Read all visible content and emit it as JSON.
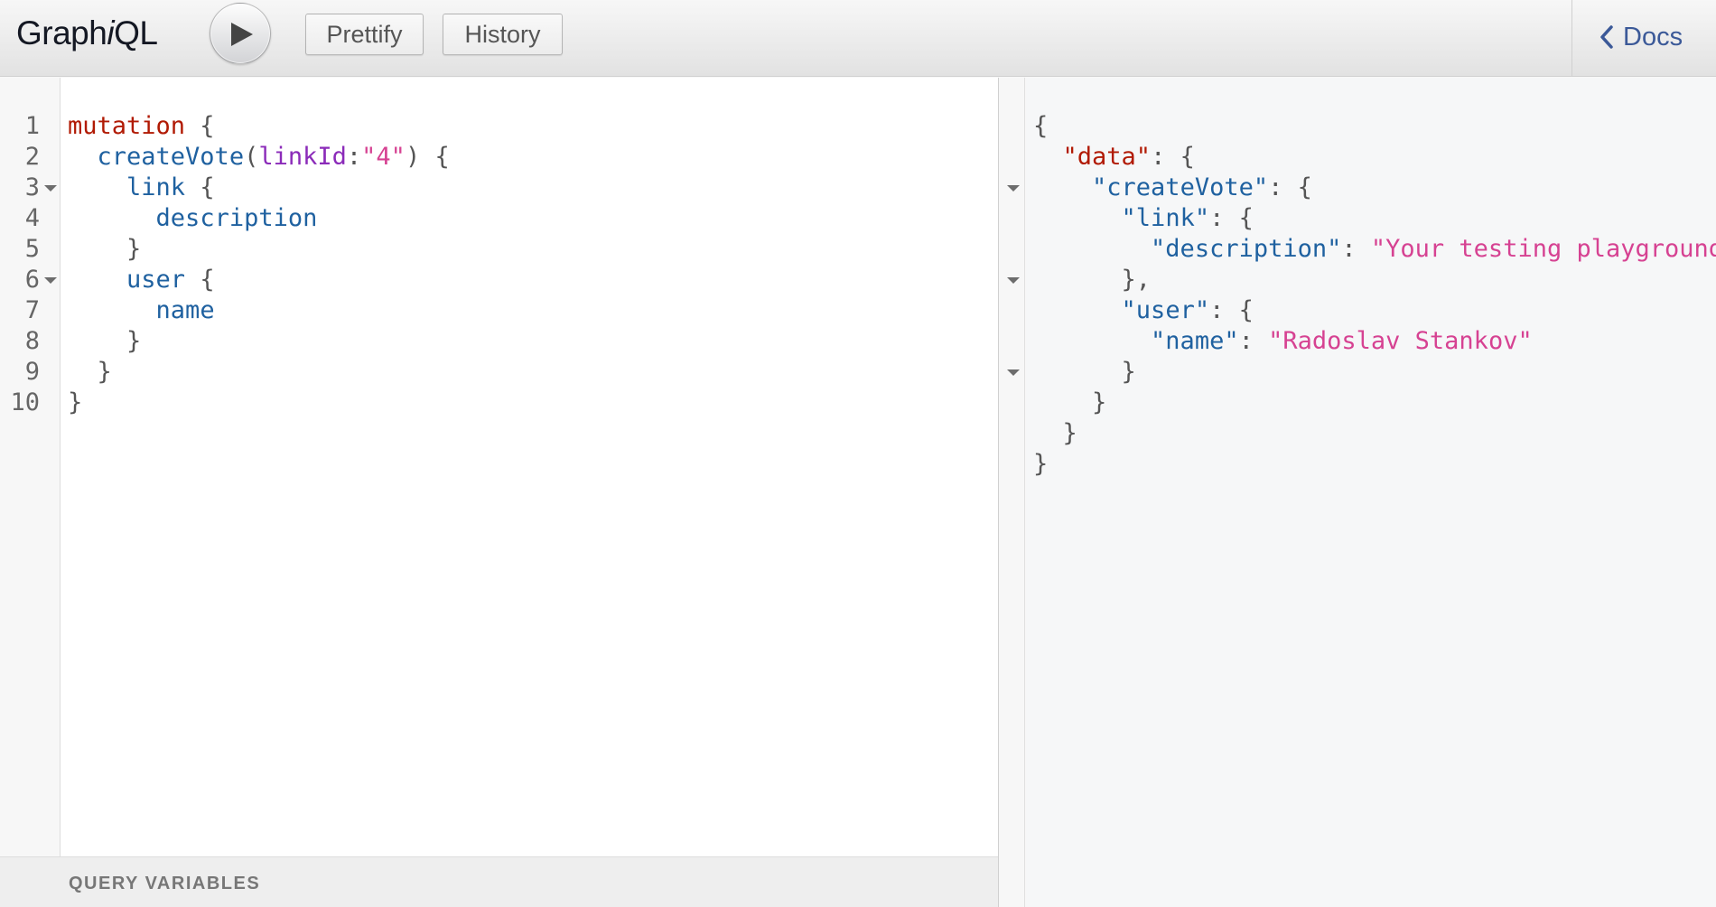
{
  "app": {
    "title_prefix": "Graph",
    "title_italic": "i",
    "title_suffix": "QL"
  },
  "toolbar": {
    "execute_icon": "play-icon",
    "prettify_label": "Prettify",
    "history_label": "History",
    "docs_label": "Docs",
    "docs_icon": "chevron-left-icon"
  },
  "query": {
    "line_numbers": [
      "1",
      "2",
      "3",
      "4",
      "5",
      "6",
      "7",
      "8",
      "9",
      "10"
    ],
    "lines": [
      "mutation {",
      "  createVote(linkId:\"4\") {",
      "    link {",
      "      description",
      "    }",
      "    user {",
      "      name",
      "    }",
      "  }",
      "}"
    ],
    "tokens": {
      "mutation": "mutation",
      "field_createVote": "createVote",
      "arg_name": "linkId",
      "arg_value": "\"4\"",
      "field_link": "link",
      "field_description": "description",
      "field_user": "user",
      "field_name": "name"
    }
  },
  "variables_panel": {
    "label": "QUERY VARIABLES"
  },
  "result": {
    "lines": [
      "{",
      "  \"data\": {",
      "    \"createVote\": {",
      "      \"link\": {",
      "        \"description\": \"Your testing playground\"",
      "      },",
      "      \"user\": {",
      "        \"name\": \"Radoslav Stankov\"",
      "      }",
      "    }",
      "  }",
      "}"
    ],
    "tokens": {
      "data_key": "\"data\"",
      "createVote_key": "\"createVote\"",
      "link_key": "\"link\"",
      "description_key": "\"description\"",
      "description_value": "\"Your testing playground\"",
      "user_key": "\"user\"",
      "name_key": "\"name\"",
      "name_value": "\"Radoslav Stankov\""
    }
  },
  "colors": {
    "keyword": "#b11a04",
    "field": "#1f61a0",
    "argument": "#8b2bb9",
    "string": "#d64292",
    "docs_link": "#3b5998"
  }
}
